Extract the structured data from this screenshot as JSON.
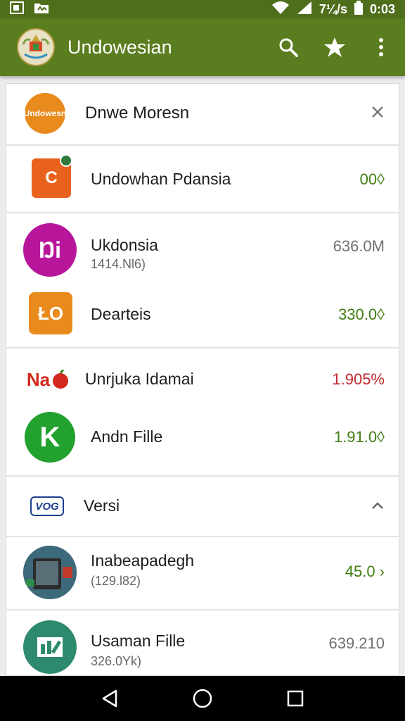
{
  "status_bar": {
    "time": "0:03",
    "signal_text": "7¼/s",
    "icons": [
      "image-notification-icon",
      "folder-notification-icon",
      "wifi-icon",
      "cell-signal-icon",
      "battery-icon"
    ]
  },
  "app_bar": {
    "title": "Undowesian",
    "actions": [
      "search-icon",
      "star-icon",
      "overflow-menu-icon"
    ]
  },
  "header_row": {
    "logo_text": "Undowesn",
    "title": "Dnwe Moresn"
  },
  "items": [
    {
      "icon_text": "C",
      "title": "Undowhan Pdansia",
      "value": "00◊"
    },
    {
      "icon_text": "Ŋi",
      "title": "Ukdonsia",
      "subtitle": "1414.Nl6)",
      "value": "636.0M"
    },
    {
      "icon_text": "ŁO",
      "title": "Dearteis",
      "value": "330.0◊"
    },
    {
      "icon_text": "Na",
      "title": "Unrjuka Idamai",
      "value": "1.905%"
    },
    {
      "icon_text": "K",
      "title": "Andn Fille",
      "value": "1.91.0◊"
    }
  ],
  "section": {
    "badge": "VOG",
    "title": "Versi"
  },
  "items_2": [
    {
      "title": "Inabeapadegh",
      "subtitle": "(129.l82)",
      "value": "45.0 ›"
    },
    {
      "title": "Usaman Fille",
      "subtitle": "326.0Yk)",
      "value": "639.210"
    }
  ],
  "colors": {
    "status_bar": "#4f6e1c",
    "app_bar": "#5a7d1f",
    "value_green": "#3f7d12",
    "value_red": "#c0282c",
    "nav_bar": "#000000"
  },
  "nav_bar": {
    "buttons": [
      "back-icon",
      "home-icon",
      "recents-icon"
    ]
  }
}
